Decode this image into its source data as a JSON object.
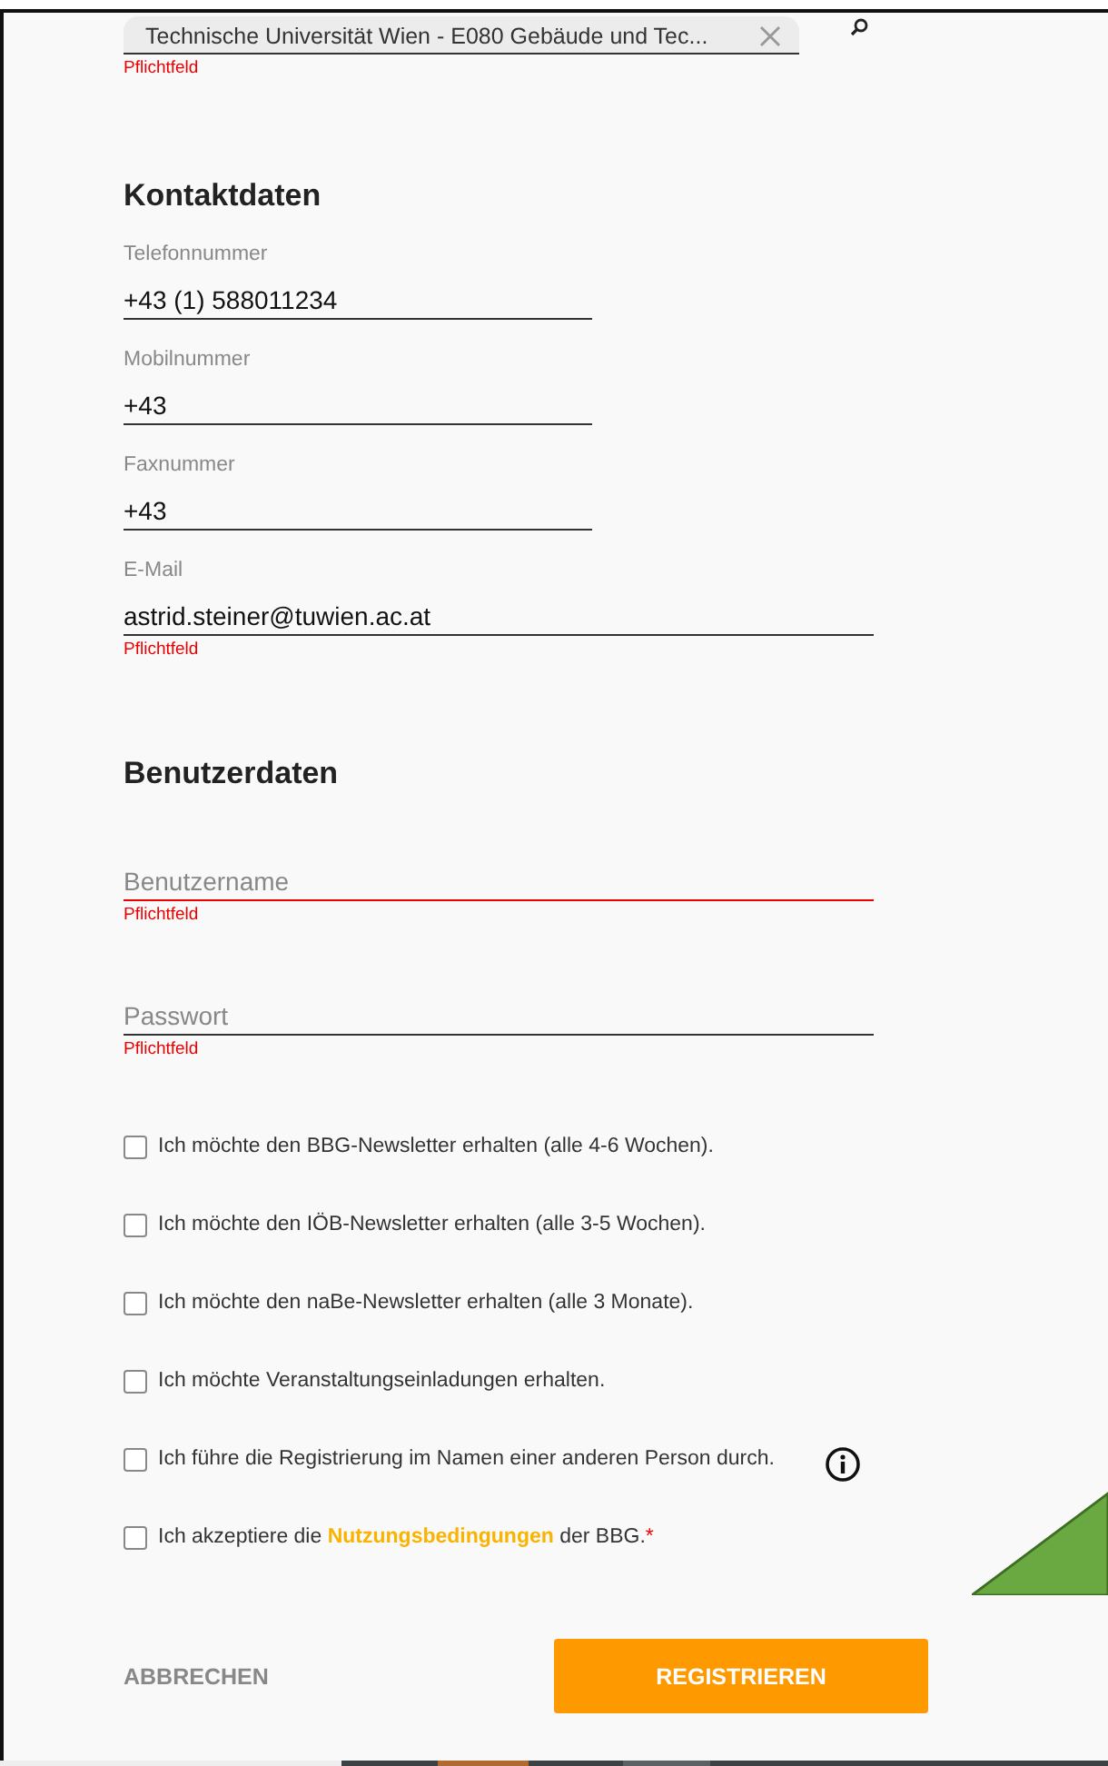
{
  "organisation": {
    "value": "Technische Universität Wien - E080 Gebäude und Tec...",
    "error": "Pflichtfeld"
  },
  "sections": [
    {
      "title": "Kontaktdaten",
      "fields": [
        {
          "label": "Telefonnummer",
          "value": "+43 (1) 588011234",
          "wide": false,
          "invalid": false
        },
        {
          "label": "Mobilnummer",
          "value": "+43",
          "wide": false,
          "invalid": false
        },
        {
          "label": "Faxnummer",
          "value": "+43",
          "wide": false,
          "invalid": false
        },
        {
          "label": "E-Mail",
          "value": "astrid.steiner@tuwien.ac.at",
          "wide": true,
          "invalid": false,
          "error": "Pflichtfeld"
        }
      ]
    },
    {
      "title": "Benutzerdaten",
      "fields": [
        {
          "placeholder": "Benutzername",
          "wide": true,
          "invalid": true,
          "error": "Pflichtfeld"
        },
        {
          "placeholder": "Passwort",
          "wide": true,
          "invalid": false,
          "error": "Pflichtfeld"
        }
      ]
    }
  ],
  "checkboxes": [
    {
      "label": "Ich möchte den BBG-Newsletter erhalten (alle 4-6 Wochen).",
      "checked": false
    },
    {
      "label": "Ich möchte den IÖB-Newsletter erhalten (alle 3-5 Wochen).",
      "checked": false
    },
    {
      "label": "Ich möchte den naBe-Newsletter erhalten (alle 3 Monate).",
      "checked": false
    },
    {
      "label": "Ich möchte Veranstaltungseinladungen erhalten.",
      "checked": false
    },
    {
      "label": "Ich führe die Registrierung im Namen einer anderen Person durch.",
      "checked": false,
      "info": true
    },
    {
      "label": "Ich akzeptiere die ",
      "link": "Nutzungsbedingungen",
      "after": " der BBG.",
      "required": "*",
      "checked": false
    }
  ],
  "buttons": {
    "cancel": "ABBRECHEN",
    "submit": "REGISTRIEREN"
  }
}
